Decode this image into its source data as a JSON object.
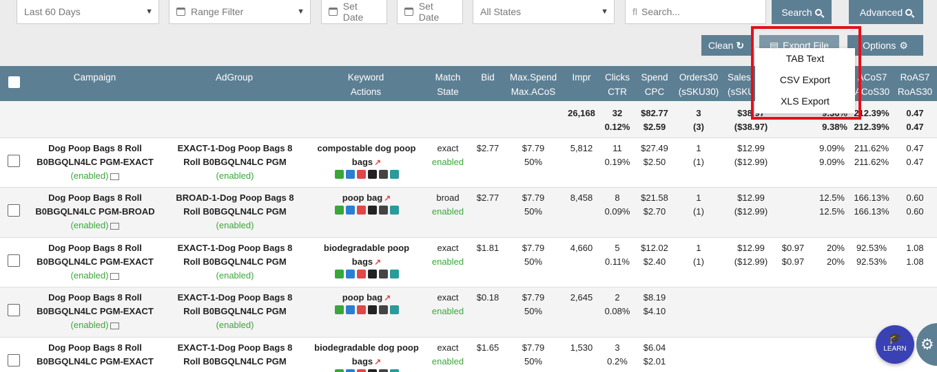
{
  "filters": {
    "date_range": "Last 60 Days",
    "range_filter": "Range Filter",
    "set_date_1": "Set Date",
    "set_date_2": "Set Date",
    "states": "All States",
    "search_placeholder": "Search...",
    "search_button": "Search",
    "advanced_button": "Advanced"
  },
  "actions": {
    "clean": "Clean",
    "export": "Export File",
    "options": "Options"
  },
  "export_menu": [
    "TAB Text",
    "CSV Export",
    "XLS Export"
  ],
  "headers": {
    "campaign": "Campaign",
    "adgroup": "AdGroup",
    "keyword": "Keyword",
    "keyword_sub": "Actions",
    "match": "Match",
    "match_sub": "State",
    "bid": "Bid",
    "maxspend": "Max.Spend",
    "maxspend_sub": "Max.ACoS",
    "impr": "Impr",
    "clicks": "Clicks",
    "clicks_sub": "CTR",
    "spend": "Spend",
    "spend_sub": "CPC",
    "orders": "Orders30",
    "orders_sub": "(sSKU30)",
    "sales": "Sales",
    "sales_sub": "(sSKU",
    "acos": "ACoS7",
    "acos_sub": "ACoS30",
    "roas": "RoAS7",
    "roas_sub": "RoAS30"
  },
  "totals": {
    "impr": "26,168",
    "clicks": "32",
    "ctr": "0.12%",
    "spend": "$82.77",
    "cpc": "$2.59",
    "orders": "3",
    "orders_sub": "(3)",
    "sales": "$38.97",
    "sales_sub": "($38.97)",
    "acos_pct1": "9.36%",
    "acos_pct2": "9.38%",
    "acos7": "212.39%",
    "acos30": "212.39%",
    "roas7": "0.47",
    "roas30": "0.47"
  },
  "rows": [
    {
      "campaign": "Dog Poop Bags 8 Roll",
      "campaign2": "B0BGQLN4LC PGM-EXACT",
      "status": "(enabled)",
      "adgroup": "EXACT-1-Dog Poop Bags 8",
      "adgroup2": "Roll B0BGQLN4LC PGM",
      "ag_status": "(enabled)",
      "keyword": "compostable dog poop",
      "keyword2": "bags",
      "match": "exact",
      "state": "enabled",
      "bid": "$2.77",
      "maxspend": "$7.79",
      "maxacos": "50%",
      "impr": "5,812",
      "clicks": "11",
      "ctr": "0.19%",
      "spend": "$27.49",
      "cpc": "$2.50",
      "orders": "1",
      "orders_sub": "(1)",
      "sales": "$12.99",
      "sales_sub": "($12.99)",
      "mid1": "",
      "mid2": "",
      "pct1": "9.09%",
      "pct2": "9.09%",
      "acos7": "211.62%",
      "acos30": "211.62%",
      "roas7": "0.47",
      "roas30": "0.47"
    },
    {
      "campaign": "Dog Poop Bags 8 Roll",
      "campaign2": "B0BGQLN4LC PGM-BROAD",
      "status": "(enabled)",
      "adgroup": "BROAD-1-Dog Poop Bags 8",
      "adgroup2": "Roll B0BGQLN4LC PGM",
      "ag_status": "(enabled)",
      "keyword": "poop bag",
      "keyword2": "",
      "match": "broad",
      "state": "enabled",
      "bid": "$2.77",
      "maxspend": "$7.79",
      "maxacos": "50%",
      "impr": "8,458",
      "clicks": "8",
      "ctr": "0.09%",
      "spend": "$21.58",
      "cpc": "$2.70",
      "orders": "1",
      "orders_sub": "(1)",
      "sales": "$12.99",
      "sales_sub": "($12.99)",
      "mid1": "",
      "mid2": "",
      "pct1": "12.5%",
      "pct2": "12.5%",
      "acos7": "166.13%",
      "acos30": "166.13%",
      "roas7": "0.60",
      "roas30": "0.60"
    },
    {
      "campaign": "Dog Poop Bags 8 Roll",
      "campaign2": "B0BGQLN4LC PGM-EXACT",
      "status": "(enabled)",
      "adgroup": "EXACT-1-Dog Poop Bags 8",
      "adgroup2": "Roll B0BGQLN4LC PGM",
      "ag_status": "(enabled)",
      "keyword": "biodegradable poop",
      "keyword2": "bags",
      "match": "exact",
      "state": "enabled",
      "bid": "$1.81",
      "maxspend": "$7.79",
      "maxacos": "50%",
      "impr": "4,660",
      "clicks": "5",
      "ctr": "0.11%",
      "spend": "$12.02",
      "cpc": "$2.40",
      "orders": "1",
      "orders_sub": "(1)",
      "sales": "$12.99",
      "sales_sub": "($12.99)",
      "mid1": "$0.97",
      "mid2": "$0.97",
      "pct1": "20%",
      "pct2": "20%",
      "acos7": "92.53%",
      "acos30": "92.53%",
      "roas7": "1.08",
      "roas30": "1.08"
    },
    {
      "campaign": "Dog Poop Bags 8 Roll",
      "campaign2": "B0BGQLN4LC PGM-EXACT",
      "status": "(enabled)",
      "adgroup": "EXACT-1-Dog Poop Bags 8",
      "adgroup2": "Roll B0BGQLN4LC PGM",
      "ag_status": "(enabled)",
      "keyword": "poop bag",
      "keyword2": "",
      "match": "exact",
      "state": "enabled",
      "bid": "$0.18",
      "maxspend": "$7.79",
      "maxacos": "50%",
      "impr": "2,645",
      "clicks": "2",
      "ctr": "0.08%",
      "spend": "$8.19",
      "cpc": "$4.10",
      "orders": "",
      "orders_sub": "",
      "sales": "",
      "sales_sub": "",
      "mid1": "",
      "mid2": "",
      "pct1": "",
      "pct2": "",
      "acos7": "",
      "acos30": "",
      "roas7": "",
      "roas30": ""
    },
    {
      "campaign": "Dog Poop Bags 8 Roll",
      "campaign2": "B0BGQLN4LC PGM-EXACT",
      "status": "",
      "adgroup": "EXACT-1-Dog Poop Bags 8",
      "adgroup2": "Roll B0BGQLN4LC PGM",
      "ag_status": "",
      "keyword": "biodegradable dog poop",
      "keyword2": "bags",
      "match": "exact",
      "state": "enabled",
      "bid": "$1.65",
      "maxspend": "$7.79",
      "maxacos": "50%",
      "impr": "1,530",
      "clicks": "3",
      "ctr": "0.2%",
      "spend": "$6.04",
      "cpc": "$2.01",
      "orders": "",
      "orders_sub": "",
      "sales": "",
      "sales_sub": "",
      "mid1": "",
      "mid2": "",
      "pct1": "",
      "pct2": "",
      "acos7": "",
      "acos30": "",
      "roas7": "",
      "roas30": ""
    }
  ],
  "learn_label": "LEARN",
  "colors": {
    "header": "#5d7f93",
    "enabled": "#3aa63a",
    "highlight": "#e3101a",
    "learn": "#3a41b4"
  }
}
